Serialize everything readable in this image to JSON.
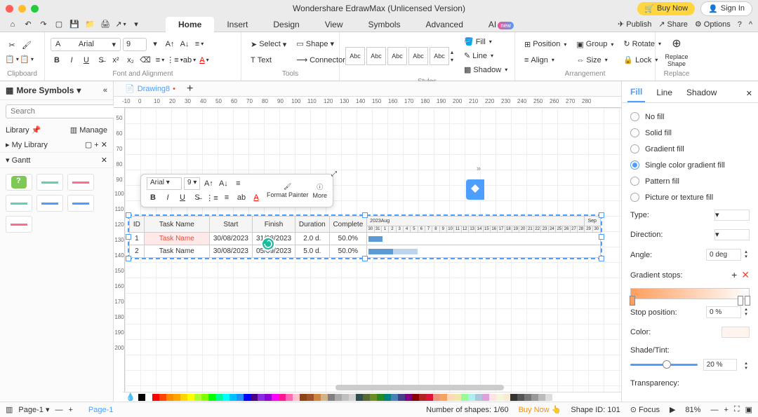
{
  "titlebar": {
    "title": "Wondershare EdrawMax (Unlicensed Version)",
    "buy_now": "Buy Now",
    "sign_in": "Sign In"
  },
  "menubar": {
    "tabs": [
      "Home",
      "Insert",
      "Design",
      "View",
      "Symbols",
      "Advanced",
      "AI"
    ],
    "active_tab": "Home",
    "publish": "Publish",
    "share": "Share",
    "options": "Options"
  },
  "ribbon": {
    "clipboard_label": "Clipboard",
    "font_and_alignment_label": "Font and Alignment",
    "tools_label": "Tools",
    "styles_label": "Styles",
    "arrangement_label": "Arrangement",
    "replace_label": "Replace",
    "font_name": "Arial",
    "font_size": "9",
    "select_label": "Select",
    "text_label": "Text",
    "shape_label": "Shape",
    "connector_label": "Connector",
    "style_box": "Abc",
    "fill_label": "Fill",
    "line_label": "Line",
    "shadow_label": "Shadow",
    "position_label": "Position",
    "align_label": "Align",
    "group_label": "Group",
    "size_label": "Size",
    "rotate_label": "Rotate",
    "lock_label": "Lock",
    "replace_shape_label": "Replace Shape"
  },
  "left_sidebar": {
    "title": "More Symbols",
    "search_placeholder": "Search",
    "search_btn": "Search",
    "library_label": "Library",
    "manage_label": "Manage",
    "my_library_label": "My Library",
    "gantt_label": "Gantt"
  },
  "doc_tab": {
    "name": "Drawing8",
    "modified": "•"
  },
  "float_toolbar": {
    "font": "Arial",
    "size": "9",
    "format_painter": "Format Painter",
    "more": "More"
  },
  "gantt": {
    "headers": [
      "ID",
      "Task Name",
      "Start",
      "Finish",
      "Duration",
      "Complete"
    ],
    "timeline_month1": "2023Aug",
    "timeline_month2": "Sep",
    "timeline_days": [
      "30",
      "31",
      "1",
      "2",
      "3",
      "4",
      "5",
      "6",
      "7",
      "8",
      "9",
      "10",
      "11",
      "12",
      "13",
      "14",
      "15",
      "16",
      "17",
      "18",
      "19",
      "20",
      "21",
      "22",
      "23",
      "24",
      "25",
      "26",
      "27",
      "28",
      "29",
      "30"
    ],
    "rows": [
      {
        "id": "1",
        "name": "Task Name",
        "start": "30/08/2023",
        "finish": "31/08/2023",
        "duration": "2.0 d.",
        "complete": "50.0%"
      },
      {
        "id": "2",
        "name": "Task Name",
        "start": "30/08/2023",
        "finish": "05/09/2023",
        "duration": "5.0 d.",
        "complete": "50.0%"
      }
    ]
  },
  "right_sidebar": {
    "tab_fill": "Fill",
    "tab_line": "Line",
    "tab_shadow": "Shadow",
    "no_fill": "No fill",
    "solid_fill": "Solid fill",
    "gradient_fill": "Gradient fill",
    "single_color_gradient_fill": "Single color gradient fill",
    "pattern_fill": "Pattern fill",
    "picture_texture_fill": "Picture or texture fill",
    "type_label": "Type:",
    "direction_label": "Direction:",
    "angle_label": "Angle:",
    "angle_value": "0 deg",
    "gradient_stops_label": "Gradient stops:",
    "stop_position_label": "Stop position:",
    "stop_position_value": "0 %",
    "color_label": "Color:",
    "shade_tint_label": "Shade/Tint:",
    "shade_tint_value": "20 %",
    "transparency_label": "Transparency:"
  },
  "statusbar": {
    "page_select": "Page-1",
    "page_tab": "Page-1",
    "shapes_count": "Number of shapes: 1/60",
    "buy_now": "Buy Now",
    "shape_id": "Shape ID: 101",
    "focus": "Focus",
    "zoom": "81%"
  }
}
